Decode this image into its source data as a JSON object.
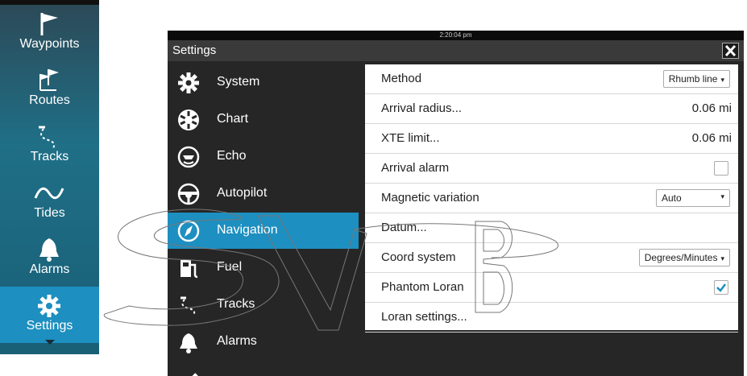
{
  "leftnav": {
    "items": [
      {
        "label": "Waypoints",
        "icon": "flag-icon"
      },
      {
        "label": "Routes",
        "icon": "route-flags-icon"
      },
      {
        "label": "Tracks",
        "icon": "track-icon"
      },
      {
        "label": "Tides",
        "icon": "wave-icon"
      },
      {
        "label": "Alarms",
        "icon": "bell-icon"
      },
      {
        "label": "Settings",
        "icon": "gear-icon",
        "active": true
      }
    ]
  },
  "window": {
    "clock": "2:20:04 pm",
    "title": "Settings",
    "close_icon": "close-icon"
  },
  "categories": [
    {
      "label": "System",
      "icon": "gear-icon"
    },
    {
      "label": "Chart",
      "icon": "chart-wheel-icon"
    },
    {
      "label": "Echo",
      "icon": "sonar-icon"
    },
    {
      "label": "Autopilot",
      "icon": "helm-icon"
    },
    {
      "label": "Navigation",
      "icon": "compass-icon",
      "active": true
    },
    {
      "label": "Fuel",
      "icon": "fuel-pump-icon"
    },
    {
      "label": "Tracks",
      "icon": "track-icon"
    },
    {
      "label": "Alarms",
      "icon": "bell-icon"
    }
  ],
  "settings": {
    "method": {
      "label": "Method",
      "value": "Rhumb line"
    },
    "arrival_radius": {
      "label": "Arrival radius...",
      "value": "0.06 mi"
    },
    "xte_limit": {
      "label": "XTE limit...",
      "value": "0.06 mi"
    },
    "arrival_alarm": {
      "label": "Arrival alarm",
      "checked": false
    },
    "magnetic_variation": {
      "label": "Magnetic variation",
      "value": "Auto"
    },
    "datum": {
      "label": "Datum..."
    },
    "coord_system": {
      "label": "Coord system",
      "value": "Degrees/Minutes"
    },
    "phantom_loran": {
      "label": "Phantom Loran",
      "checked": true
    },
    "loran_settings": {
      "label": "Loran settings..."
    }
  },
  "colors": {
    "accent": "#1d8fc0",
    "dark": "#262626",
    "check": "#1d8fc0"
  }
}
